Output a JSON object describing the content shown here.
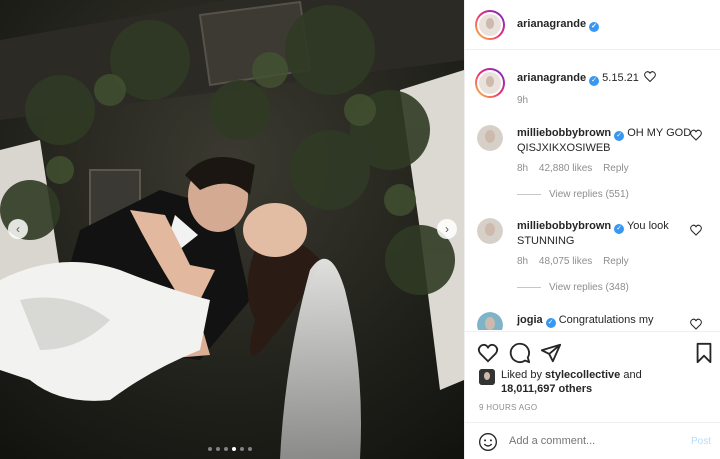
{
  "post": {
    "author": "arianagrande",
    "caption": "5.15.21",
    "caption_time": "9h",
    "likes_by": "stylecollective",
    "likes_prefix": "Liked by",
    "likes_conj": "and",
    "likes_count": "18,011,697 others",
    "time_ago": "9 HOURS AGO",
    "carousel": {
      "count": 6,
      "active": 3
    }
  },
  "comments": [
    {
      "user": "milliebobbybrown",
      "text": "OH MY GOD QISJXIKXOSIWEB",
      "time": "8h",
      "likes": "42,880 likes",
      "reply_label": "Reply",
      "view_replies": "View replies (551)"
    },
    {
      "user": "milliebobbybrown",
      "text": "You look STUNNING",
      "time": "8h",
      "likes": "48,075 likes",
      "reply_label": "Reply",
      "view_replies": "View replies (348)"
    },
    {
      "user": "jogia",
      "text": "Congratulations my"
    }
  ],
  "add_comment": {
    "placeholder": "Add a comment...",
    "post_label": "Post"
  },
  "icons": {
    "verified": "verified-badge-icon",
    "heart": "heart-icon",
    "comment": "comment-icon",
    "share": "share-icon",
    "save": "bookmark-icon",
    "emoji": "emoji-icon",
    "prev": "chevron-left-icon",
    "next": "chevron-right-icon"
  },
  "colors": {
    "link_blue": "#3897f0",
    "post_disabled": "#b2dffc",
    "muted": "#8e8e8e"
  }
}
